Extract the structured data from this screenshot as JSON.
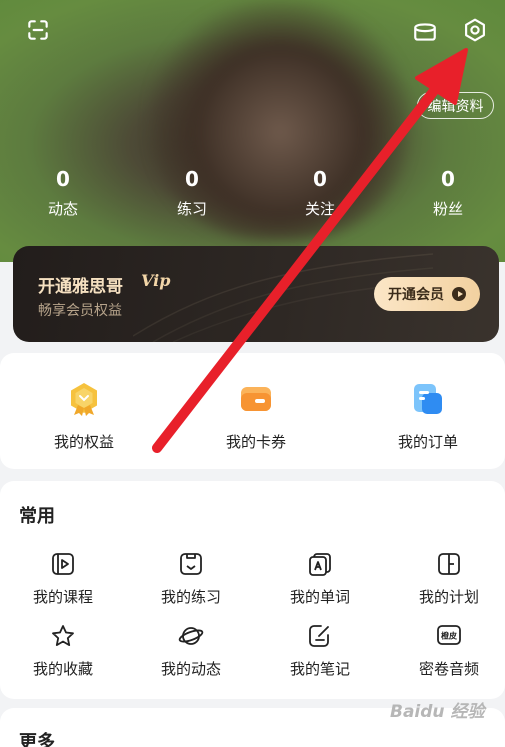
{
  "header": {
    "edit_profile_label": "编辑资料",
    "stats": [
      {
        "value": "0",
        "label": "动态"
      },
      {
        "value": "0",
        "label": "练习"
      },
      {
        "value": "0",
        "label": "关注"
      },
      {
        "value": "0",
        "label": "粉丝"
      }
    ]
  },
  "vip": {
    "title": "开通雅思哥",
    "badge": "Vip",
    "subtitle": "畅享会员权益",
    "button_label": "开通会员"
  },
  "quick_actions": [
    {
      "label": "我的权益",
      "icon": "medal-icon"
    },
    {
      "label": "我的卡券",
      "icon": "coupon-icon"
    },
    {
      "label": "我的订单",
      "icon": "order-icon"
    }
  ],
  "common": {
    "title": "常用",
    "items": [
      {
        "label": "我的课程",
        "icon": "course-icon"
      },
      {
        "label": "我的练习",
        "icon": "practice-icon"
      },
      {
        "label": "我的单词",
        "icon": "word-icon"
      },
      {
        "label": "我的计划",
        "icon": "plan-icon"
      },
      {
        "label": "我的收藏",
        "icon": "star-icon"
      },
      {
        "label": "我的动态",
        "icon": "planet-icon"
      },
      {
        "label": "我的笔记",
        "icon": "note-icon"
      },
      {
        "label": "密卷音频",
        "icon": "audio-icon"
      }
    ]
  },
  "more": {
    "title": "更多"
  },
  "watermark": "Baidu 经验",
  "colors": {
    "header_green": "#668c40",
    "vip_dark": "#2e2824",
    "vip_gold": "#f2d1a0",
    "arrow_red": "#e8202a"
  }
}
